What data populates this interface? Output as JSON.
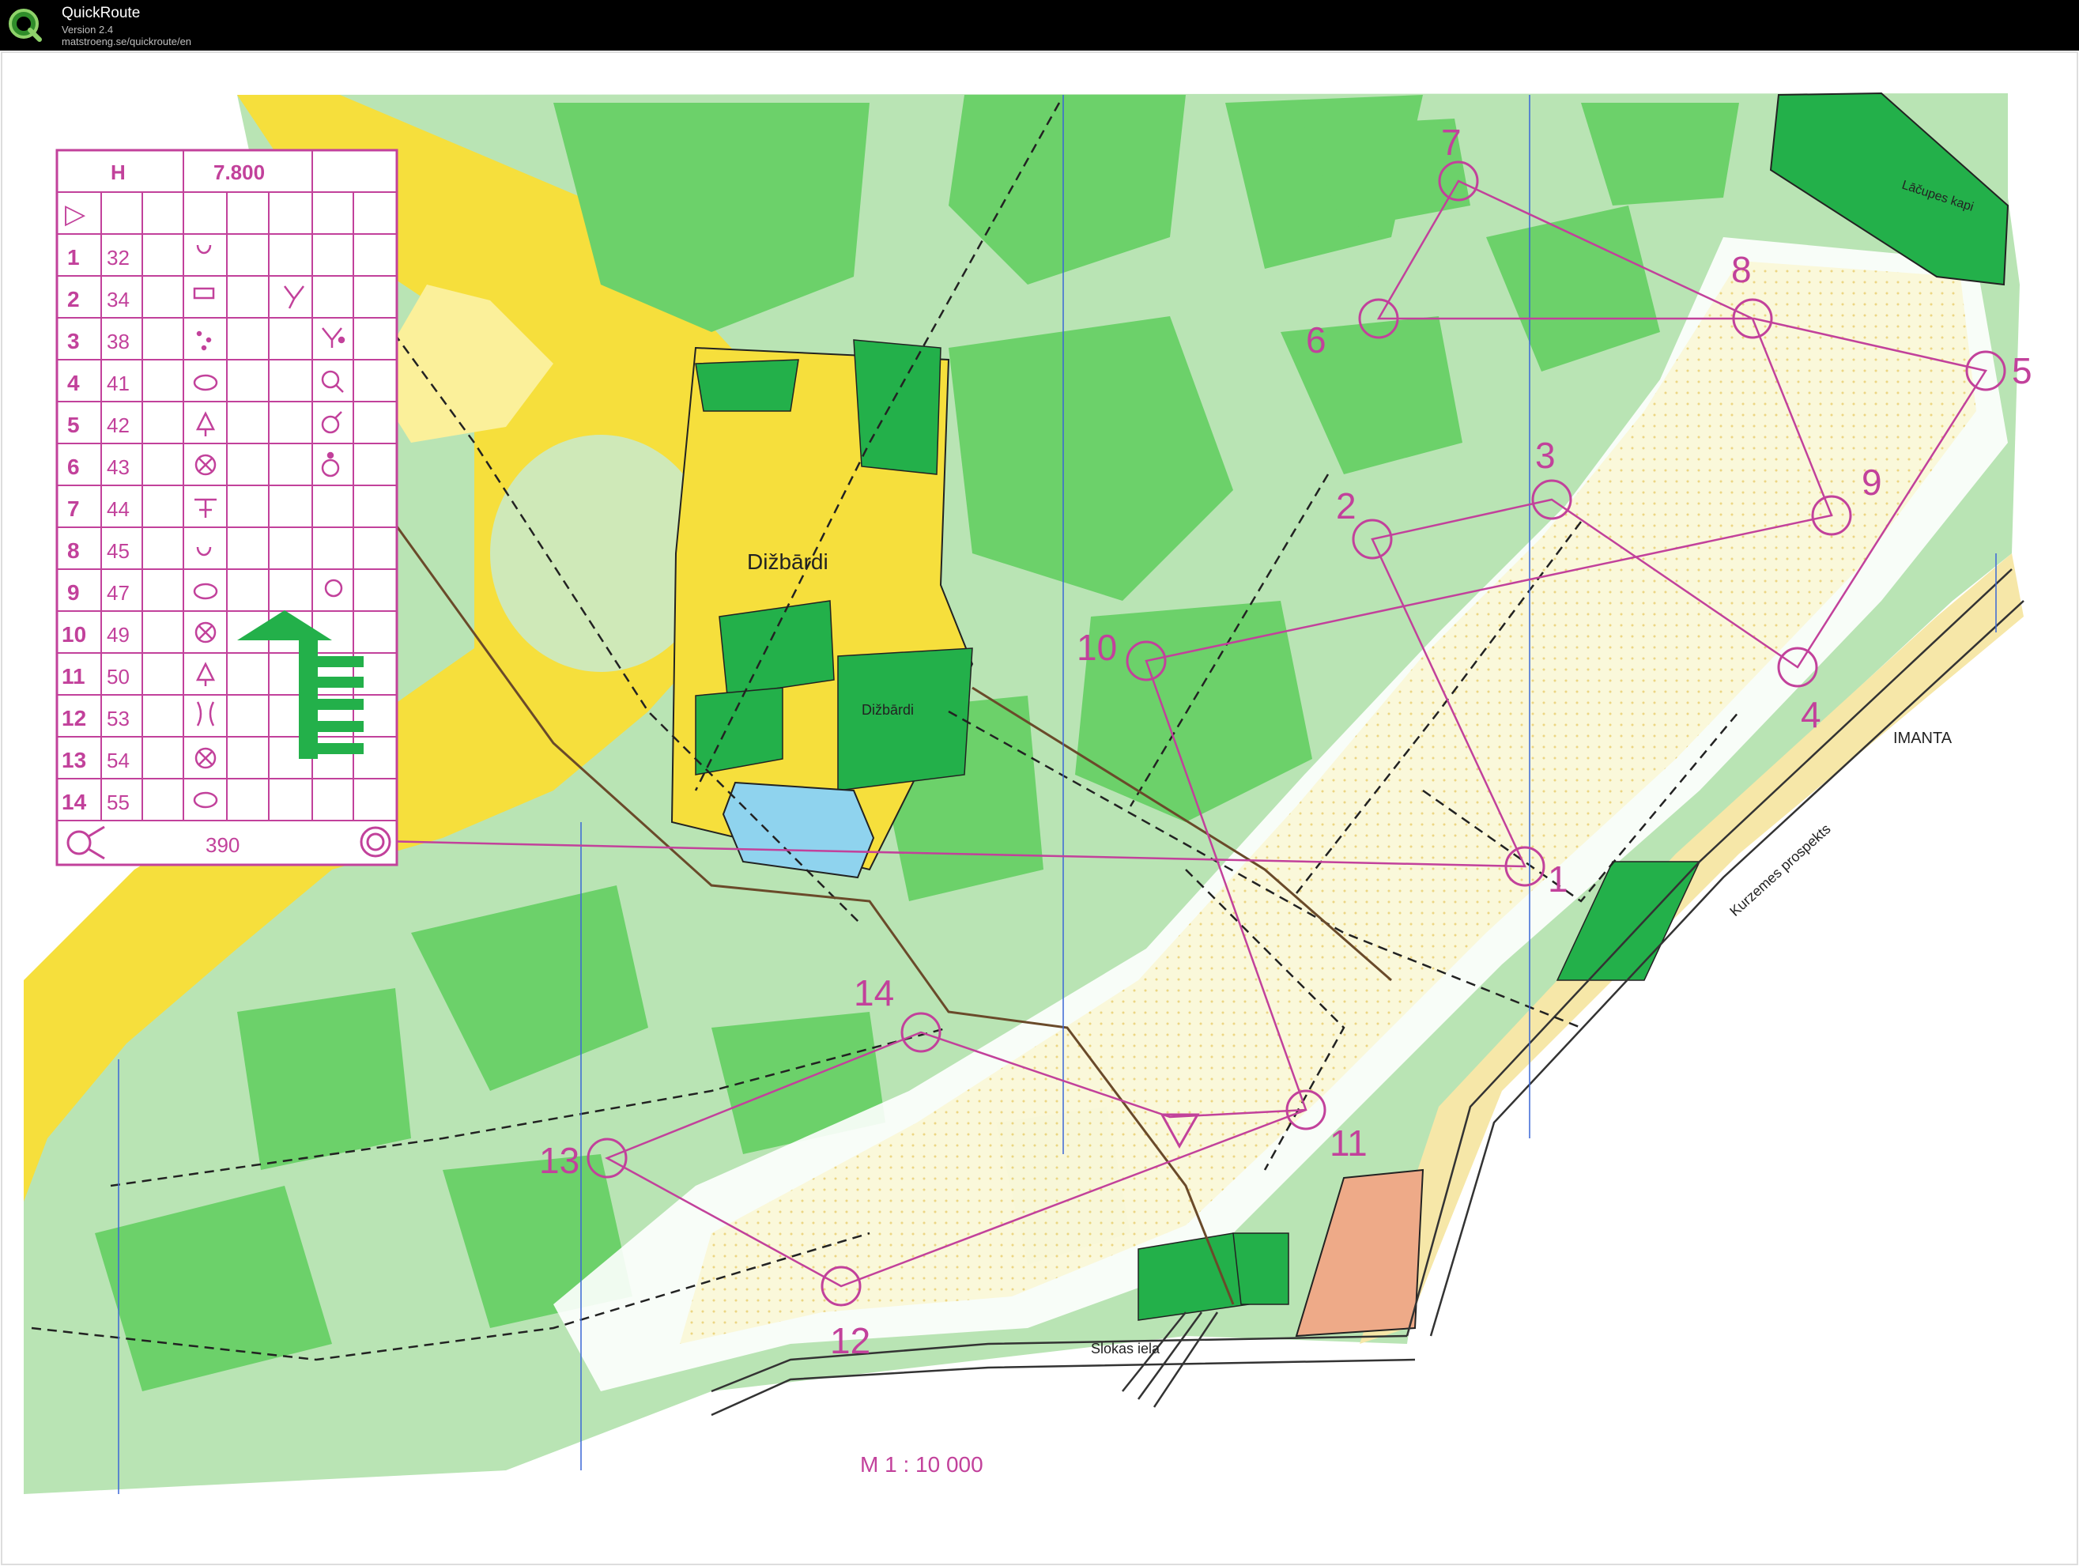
{
  "app": {
    "name": "QuickRoute",
    "version": "Version 2.4",
    "url": "matstroeng.se/quickroute/en"
  },
  "colors": {
    "course": "#c2419b",
    "forest_light": "#b9e4b4",
    "forest_mid": "#6cd16a",
    "forest_dark": "#23b04a",
    "open_yellow": "#f6df3c",
    "rough_yellow": "#fbf09a",
    "water": "#8fd3ee",
    "contour": "#d9892b",
    "built_up": "#eeaa88"
  },
  "description_sheet": {
    "class": "H",
    "length": "7.800",
    "start_symbol": "▷",
    "finish_label": "390",
    "rows": [
      {
        "num": "1",
        "code": "32"
      },
      {
        "num": "2",
        "code": "34"
      },
      {
        "num": "3",
        "code": "38"
      },
      {
        "num": "4",
        "code": "41"
      },
      {
        "num": "5",
        "code": "42"
      },
      {
        "num": "6",
        "code": "43"
      },
      {
        "num": "7",
        "code": "44"
      },
      {
        "num": "8",
        "code": "45"
      },
      {
        "num": "9",
        "code": "47"
      },
      {
        "num": "10",
        "code": "49"
      },
      {
        "num": "11",
        "code": "50"
      },
      {
        "num": "12",
        "code": "53"
      },
      {
        "num": "13",
        "code": "54"
      },
      {
        "num": "14",
        "code": "55"
      }
    ]
  },
  "map_labels": {
    "place_1": "Dižbārdi",
    "place_2": "Dižbārdi",
    "cemetery": "Lāčupes kapi",
    "district": "IMANTA",
    "street_1": "Kurzemes prospekts",
    "street_2": "Slokas iela",
    "scale": "M 1 : 10 000"
  },
  "controls": [
    {
      "label": "1"
    },
    {
      "label": "2"
    },
    {
      "label": "3"
    },
    {
      "label": "4"
    },
    {
      "label": "5"
    },
    {
      "label": "6"
    },
    {
      "label": "7"
    },
    {
      "label": "8"
    },
    {
      "label": "9"
    },
    {
      "label": "10"
    },
    {
      "label": "11"
    },
    {
      "label": "12"
    },
    {
      "label": "13"
    },
    {
      "label": "14"
    }
  ]
}
